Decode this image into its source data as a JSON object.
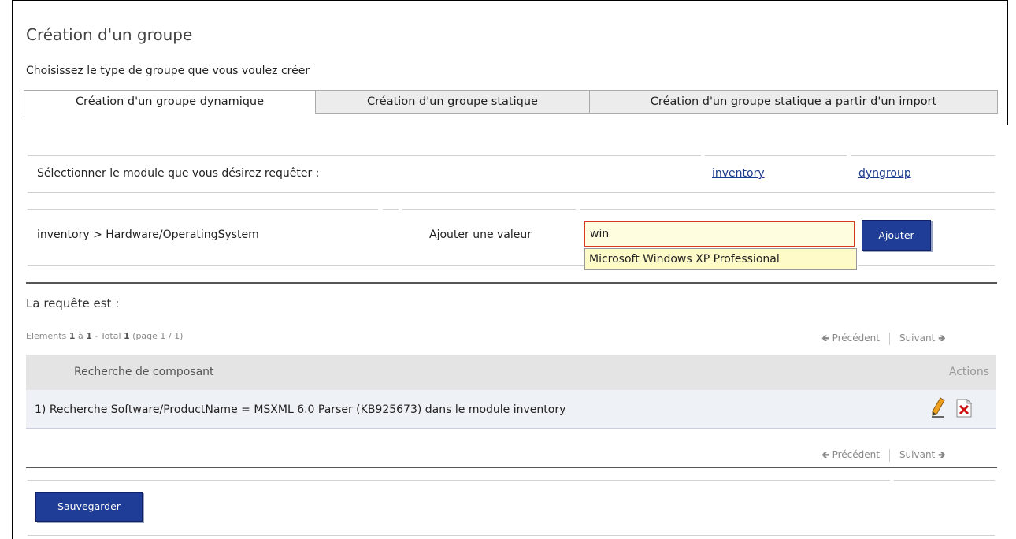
{
  "page": {
    "title": "Création d'un groupe",
    "subtitle": "Choisissez le type de groupe que vous voulez créer"
  },
  "tabs": [
    {
      "label": "Création d'un groupe dynamique",
      "active": true
    },
    {
      "label": "Création d'un groupe statique",
      "active": false
    },
    {
      "label": "Création d'un groupe statique a partir d'un import",
      "active": false
    }
  ],
  "module_select": {
    "label": "Sélectionner le module que vous désirez requêter :",
    "modules": [
      "inventory",
      "dyngroup"
    ]
  },
  "criterion": {
    "path": "inventory > Hardware/OperatingSystem",
    "add_label": "Ajouter une valeur",
    "input_value": "win",
    "suggestion": "Microsoft Windows XP Professional",
    "add_button": "Ajouter"
  },
  "request": {
    "title": "La requête est :",
    "elements_prefix": "Elements",
    "from": "1",
    "to_word": "à",
    "to": "1",
    "total_word": "- Total",
    "total": "1",
    "page_info": "(page 1 / 1)",
    "prev": "Précédent",
    "next": "Suivant",
    "column_component": "Recherche de composant",
    "column_actions": "Actions",
    "rows": [
      "1) Recherche Software/ProductName = MSXML 6.0 Parser (KB925673) dans le module inventory"
    ]
  },
  "save_button": "Sauvegarder",
  "colors": {
    "button_bg": "#1f3d96",
    "input_border": "#d6391c",
    "input_bg": "#fffde0",
    "link": "#1a3a8a"
  },
  "icons": [
    "edit-icon",
    "delete-icon",
    "arrow-left-icon",
    "arrow-right-icon"
  ]
}
